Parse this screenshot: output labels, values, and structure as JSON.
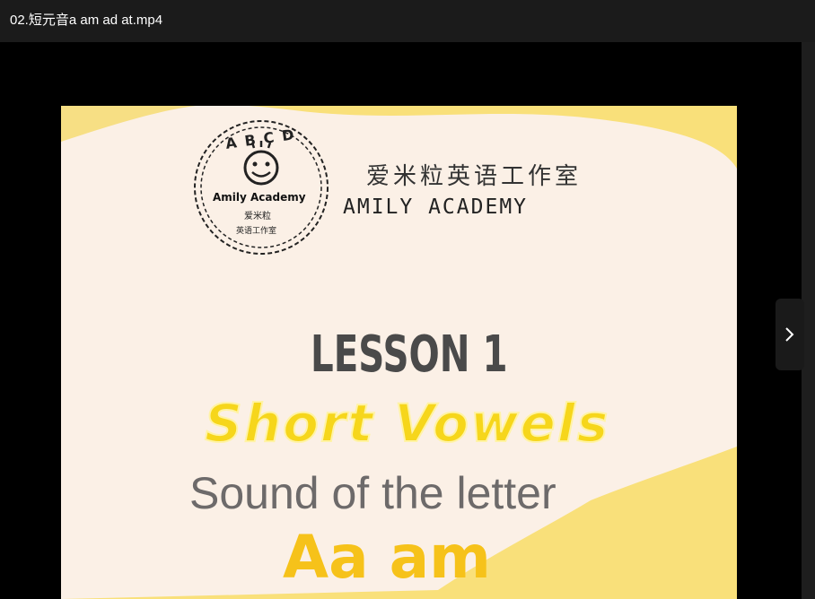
{
  "window": {
    "title": "02.短元音a am ad at.mp4"
  },
  "video": {
    "logo": {
      "arc_letters": "ABCD",
      "name": "Amily Academy",
      "cn_line1": "爱米粒",
      "cn_line2": "英语工作室"
    },
    "brand_cn": "爱米粒英语工作室",
    "brand_en": "AMILY ACADEMY",
    "lesson": "LESSON 1",
    "heading": "Short Vowels",
    "subheading": "Sound of the letter",
    "letters": "Aa am"
  },
  "controls": {
    "next_icon": "chevron-right-icon"
  },
  "colors": {
    "background": "#000000",
    "titlebar": "#1b1b1b",
    "frame_yellow": "#f9e07a",
    "paper": "#fbf0e6",
    "heading_yellow": "#f6d61b",
    "letters_yellow": "#f6c21a"
  }
}
